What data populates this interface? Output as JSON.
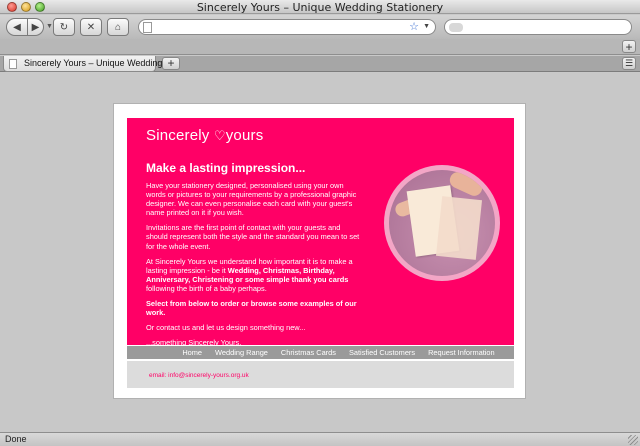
{
  "window": {
    "title": "Sincerely Yours – Unique Wedding Stationery"
  },
  "toolbar": {
    "back_glyph": "◀",
    "forward_glyph": "▶",
    "reload_glyph": "↻",
    "stop_glyph": "✕",
    "home_glyph": "⌂",
    "url_value": "",
    "search_value": ""
  },
  "tabs": [
    {
      "label": "Sincerely Yours – Unique Wedding..."
    }
  ],
  "site": {
    "logo_text_a": "Sincerely ",
    "logo_heart": "♡",
    "logo_text_b": "yours",
    "headline": "Make a lasting impression...",
    "para1": "Have your stationery designed, personalised using your own words or pictures to your requirements by a professional graphic designer. We can even personalise each card with your guest's name printed on it if you wish.",
    "para2": "Invitations are the first point of contact with your guests and should represent both the style and the standard you mean to set for the whole event.",
    "para3_start": "At Sincerely Yours we understand how important it is to make a lasting impression - be it ",
    "para3_bold": "Wedding, Christmas, Birthday, Anniversary, Christening or some simple thank you cards",
    "para3_end": " following the birth of a baby perhaps.",
    "para4": "Select from below to order or browse some examples of our work.",
    "para5": "Or contact us and let us design something new...",
    "para6": "...something Sincerely Yours.",
    "nav": [
      "Home",
      "Wedding Range",
      "Christmas Cards",
      "Satisfied Customers",
      "Request Information"
    ],
    "email": "email: info@sincerely-yours.org.uk",
    "accent_color": "#ff0066",
    "nav_color": "#9a9a9a",
    "footer_color": "#dcdcdc"
  },
  "status": {
    "text": "Done"
  }
}
